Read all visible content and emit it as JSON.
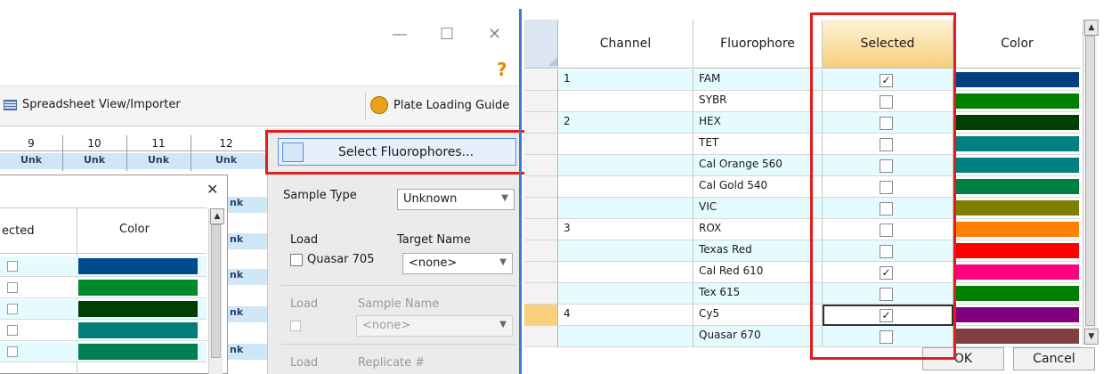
{
  "left_window": {
    "minimize_glyph": "—",
    "maximize_glyph": "☐",
    "close_glyph": "✕",
    "help_glyph": "?",
    "toolbar": {
      "spreadsheet_label": "Spreadsheet View/Importer",
      "plate_loading_guide_label": "Plate Loading Guide"
    },
    "plate_columns": [
      "9",
      "10",
      "11",
      "12"
    ],
    "plate_unk_label": "Unk",
    "side_tab_label": "nk",
    "nested_dialog": {
      "close_glyph": "✕",
      "col_selected": "ected",
      "col_color": "Color",
      "rows": [
        {
          "color": "#004B8D"
        },
        {
          "color": "#008A2E"
        },
        {
          "color": "#003F00"
        },
        {
          "color": "#007E7A"
        },
        {
          "color": "#008050"
        }
      ]
    },
    "panel": {
      "select_fluorophores_label": "Select Fluorophores...",
      "sample_type_label": "Sample Type",
      "sample_type_value": "Unknown",
      "load_label": "Load",
      "target_name_label": "Target Name",
      "quasar_label": "Quasar 705",
      "target_name_value": "<none>",
      "load2_label": "Load",
      "sample_name_label": "Sample Name",
      "sample_name_value": "<none>",
      "load3_label": "Load",
      "replicate_label": "Replicate #"
    }
  },
  "fluor_table": {
    "headers": {
      "channel": "Channel",
      "fluorophore": "Fluorophore",
      "selected": "Selected",
      "color": "Color"
    },
    "rows": [
      {
        "channel": "1",
        "fluorophore": "FAM",
        "selected": true,
        "color": "#004080"
      },
      {
        "channel": "",
        "fluorophore": "SYBR",
        "selected": false,
        "color": "#008000"
      },
      {
        "channel": "2",
        "fluorophore": "HEX",
        "selected": false,
        "color": "#004000"
      },
      {
        "channel": "",
        "fluorophore": "TET",
        "selected": false,
        "color": "#008080"
      },
      {
        "channel": "",
        "fluorophore": "Cal Orange 560",
        "selected": false,
        "color": "#008080"
      },
      {
        "channel": "",
        "fluorophore": "Cal Gold 540",
        "selected": false,
        "color": "#008040"
      },
      {
        "channel": "",
        "fluorophore": "VIC",
        "selected": false,
        "color": "#808000"
      },
      {
        "channel": "3",
        "fluorophore": "ROX",
        "selected": false,
        "color": "#FF8000"
      },
      {
        "channel": "",
        "fluorophore": "Texas Red",
        "selected": false,
        "color": "#FF0000"
      },
      {
        "channel": "",
        "fluorophore": "Cal Red 610",
        "selected": true,
        "color": "#FF0080"
      },
      {
        "channel": "",
        "fluorophore": "Tex 615",
        "selected": false,
        "color": "#008000"
      },
      {
        "channel": "4",
        "fluorophore": "Cy5",
        "selected": true,
        "color": "#800080"
      },
      {
        "channel": "",
        "fluorophore": "Quasar 670",
        "selected": false,
        "color": "#804040"
      }
    ],
    "ok_label": "OK",
    "cancel_label": "Cancel",
    "check_glyph": "✓"
  },
  "colors": {
    "highlight": "#E21D1D",
    "accent": "#3B78C7"
  }
}
